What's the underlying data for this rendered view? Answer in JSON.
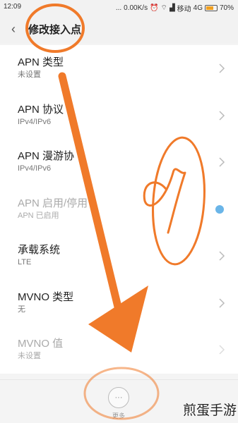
{
  "status": {
    "time": "12:09",
    "dots": "...",
    "speed": "0.00K/s",
    "carrier": "移动",
    "network": "4G",
    "battery_percent": "70%",
    "battery_level": 0.7
  },
  "header": {
    "back_icon": "back-arrow-icon",
    "title": "修改接入点"
  },
  "rows": [
    {
      "title": "APN 类型",
      "sub": "未设置",
      "control": "chevron",
      "disabled": false
    },
    {
      "title": "APN 协议",
      "sub": "IPv4/IPv6",
      "control": "chevron",
      "disabled": false
    },
    {
      "title": "APN 漫游协",
      "sub": "IPv4/IPv6",
      "control": "chevron",
      "disabled": false
    },
    {
      "title": "APN 启用/停用",
      "sub": "APN 已启用",
      "control": "toggle",
      "disabled": true
    },
    {
      "title": "承载系统",
      "sub": "LTE",
      "control": "chevron",
      "disabled": false
    },
    {
      "title": "MVNO 类型",
      "sub": "无",
      "control": "chevron",
      "disabled": false
    },
    {
      "title": "MVNO 值",
      "sub": "未设置",
      "control": "chevron",
      "disabled": true
    }
  ],
  "bottom": {
    "more_glyph": "···",
    "more_label": "更多"
  },
  "annotation": {
    "number": "1",
    "color": "#f07a2a"
  },
  "watermark": "煎蛋手游"
}
